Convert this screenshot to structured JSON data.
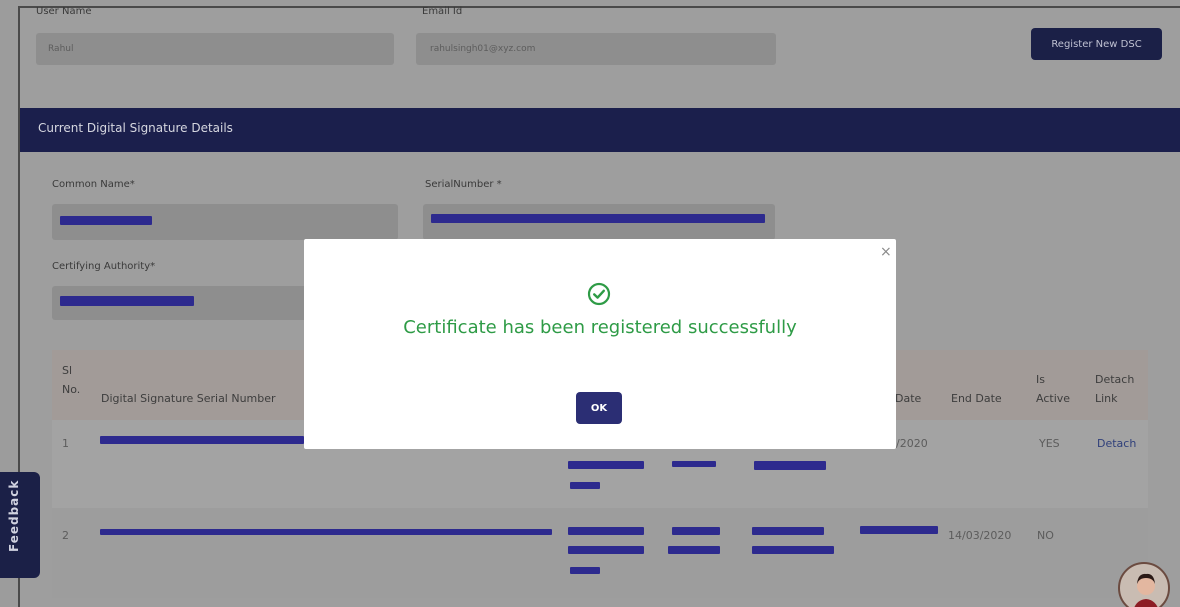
{
  "user_form": {
    "user_name_label": "User Name",
    "user_name_value": "Rahul",
    "email_label": "Email Id",
    "email_value": "rahulsingh01@xyz.com",
    "register_button": "Register New DSC"
  },
  "section": {
    "title": "Current Digital Signature Details"
  },
  "cert_form": {
    "common_name_label": "Common Name*",
    "serial_number_label": "SerialNumber *",
    "certifying_authority_label": "Certifying Authority*"
  },
  "table": {
    "headers": {
      "sl_no": "Sl No.",
      "serial_number": "Digital Signature Serial Number",
      "start_date": "Date",
      "end_date": "End Date",
      "is_active": "Is Active",
      "detach_link": "Detach Link"
    },
    "rows": [
      {
        "sl": "1",
        "start_date": "/2020",
        "end_date": "",
        "active": "YES",
        "detach": "Detach"
      },
      {
        "sl": "2",
        "start_date": "",
        "end_date": "14/03/2020",
        "active": "NO",
        "detach": ""
      }
    ]
  },
  "modal": {
    "message": "Certificate has been registered successfully",
    "ok_label": "OK",
    "close_symbol": "×"
  },
  "feedback_tab": {
    "label": "Feedback"
  },
  "colors": {
    "primary_navy": "#1b2047",
    "success_green": "#2e9b46",
    "redaction": "#2d2a8e"
  }
}
